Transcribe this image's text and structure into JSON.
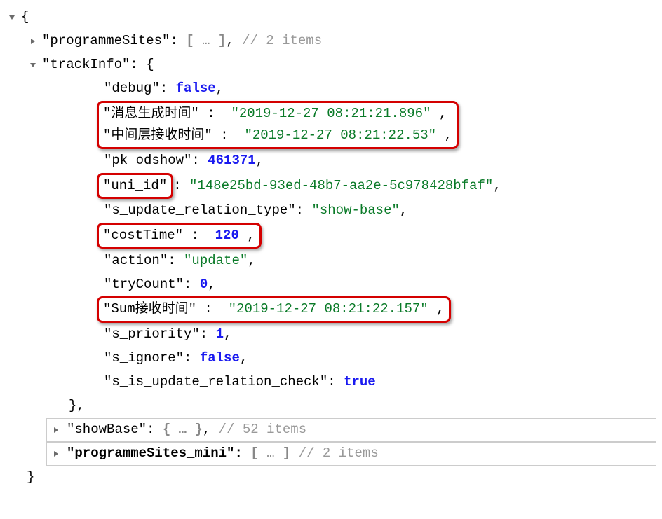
{
  "root": {
    "open_brace": "{",
    "close_brace": "}",
    "colon": ":",
    "comma": ",",
    "arr_open": "[",
    "arr_close": "]",
    "obj_placeholder": "{ … }",
    "arr_placeholder": "…"
  },
  "programmeSites": {
    "key": "\"programmeSites\"",
    "comment": "// 2 items"
  },
  "trackInfo": {
    "key": "\"trackInfo\"",
    "debug": {
      "key": "\"debug\"",
      "value": "false"
    },
    "msgGenTime": {
      "key": "\"消息生成时间\"",
      "value": "\"2019-12-27 08:21:21.896\""
    },
    "midRecvTime": {
      "key": "\"中间层接收时间\"",
      "value": "\"2019-12-27 08:21:22.53\""
    },
    "pk_odshow": {
      "key": "\"pk_odshow\"",
      "value": "461371"
    },
    "uni_id": {
      "key": "\"uni_id\"",
      "value": "\"148e25bd-93ed-48b7-aa2e-5c978428bfaf\""
    },
    "s_update_relation_type": {
      "key": "\"s_update_relation_type\"",
      "value": "\"show-base\""
    },
    "costTime": {
      "key": "\"costTime\"",
      "value": "120"
    },
    "action": {
      "key": "\"action\"",
      "value": "\"update\""
    },
    "tryCount": {
      "key": "\"tryCount\"",
      "value": "0"
    },
    "sumRecvTime": {
      "key": "\"Sum接收时间\"",
      "value": "\"2019-12-27 08:21:22.157\""
    },
    "s_priority": {
      "key": "\"s_priority\"",
      "value": "1"
    },
    "s_ignore": {
      "key": "\"s_ignore\"",
      "value": "false"
    },
    "s_is_update_relation_check": {
      "key": "\"s_is_update_relation_check\"",
      "value": "true"
    }
  },
  "showBase": {
    "key": "\"showBase\"",
    "comment": "// 52 items"
  },
  "programmeSites_mini": {
    "key": "\"programmeSites_mini\"",
    "comment": "// 2 items"
  }
}
